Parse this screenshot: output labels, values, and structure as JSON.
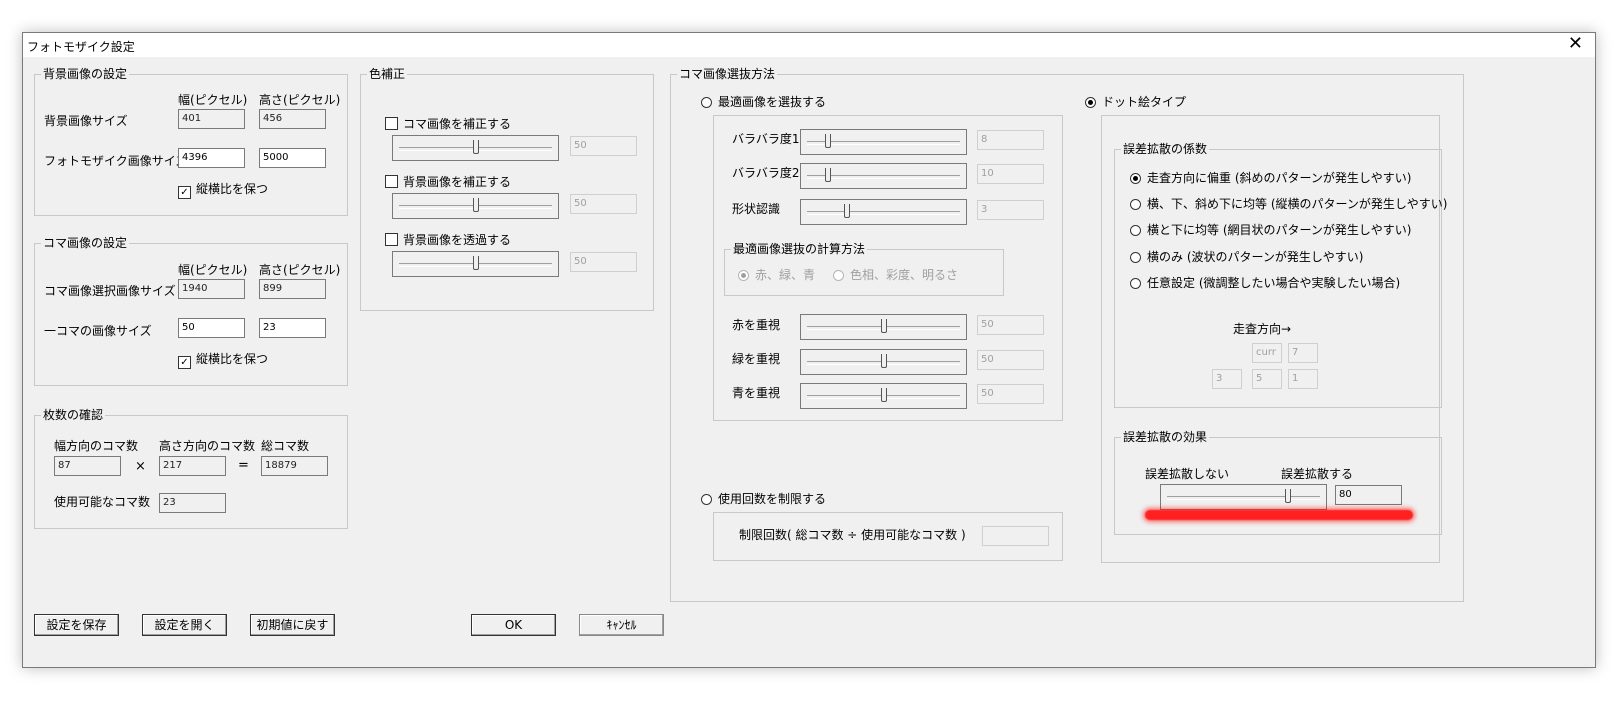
{
  "window": {
    "title": "フォトモザイク設定",
    "close_glyph": "✕"
  },
  "bg": {
    "legend": "背景画像の設定",
    "col_w": "幅(ピクセル)",
    "col_h": "高さ(ピクセル)",
    "row1": "背景画像サイズ",
    "row1_w": "401",
    "row1_h": "456",
    "row2": "フォトモザイク画像サイズ",
    "row2_w": "4396",
    "row2_h": "5000",
    "keep_ratio": "縦横比を保つ",
    "keep_ratio_checked": true
  },
  "koma": {
    "legend": "コマ画像の設定",
    "col_w": "幅(ピクセル)",
    "col_h": "高さ(ピクセル)",
    "row1": "コマ画像選択画像サイズ",
    "row1_w": "1940",
    "row1_h": "899",
    "row2": "一コマの画像サイズ",
    "row2_w": "50",
    "row2_h": "23",
    "keep_ratio": "縦横比を保つ",
    "keep_ratio_checked": true
  },
  "count": {
    "legend": "枚数の確認",
    "h1": "幅方向のコマ数",
    "h2": "高さ方向のコマ数",
    "h3": "総コマ数",
    "v1": "87",
    "times": "×",
    "v2": "217",
    "eq": "=",
    "v3": "18879",
    "usable_label": "使用可能なコマ数",
    "usable": "23"
  },
  "color": {
    "legend": "色補正",
    "c1": "コマ画像を補正する",
    "c1_value": "50",
    "c1_level": 0.5,
    "c2": "背景画像を補正する",
    "c2_value": "50",
    "c2_level": 0.5,
    "c3": "背景画像を透過する",
    "c3_value": "50",
    "c3_level": 0.5
  },
  "select": {
    "legend": "コマ画像選抜方法",
    "opt_best": "最適画像を選抜する",
    "bara1": "バラバラ度1",
    "bara1_value": "8",
    "bara2": "バラバラ度2",
    "bara2_value": "10",
    "shape": "形状認識",
    "shape_value": "3",
    "calc_legend": "最適画像選抜の計算方法",
    "calc_rgb": "赤、緑、青",
    "calc_hsv": "色相、彩度、明るさ",
    "red": "赤を重視",
    "red_value": "50",
    "green": "緑を重視",
    "green_value": "50",
    "blue": "青を重視",
    "blue_value": "50",
    "opt_limit": "使用回数を制限する",
    "limit_text": "制限回数( 総コマ数 ÷ 使用可能なコマ数 )",
    "opt_dot": "ドット絵タイプ"
  },
  "diffusion": {
    "legend": "誤差拡散の係数",
    "o1": "走査方向に偏重 (斜めのパターンが発生しやすい)",
    "o2": "横、下、斜め下に均等 (縦横のパターンが発生しやすい)",
    "o3": "横と下に均等 (網目状のパターンが発生しやすい)",
    "o4": "横のみ (波状のパターンが発生しやすい)",
    "o5": "任意設定 (微調整したい場合や実験したい場合)",
    "scan": "走査方向→",
    "curr": "curr",
    "m_right": "7",
    "m_bl": "3",
    "m_b": "5",
    "m_br": "1"
  },
  "effect": {
    "legend": "誤差拡散の効果",
    "left": "誤差拡散しない",
    "right": "誤差拡散する",
    "value": "80",
    "level": 0.8
  },
  "buttons": {
    "save": "設定を保存",
    "open": "設定を開く",
    "reset": "初期値に戻す",
    "ok": "OK",
    "cancel": "ｷｬﾝｾﾙ"
  }
}
